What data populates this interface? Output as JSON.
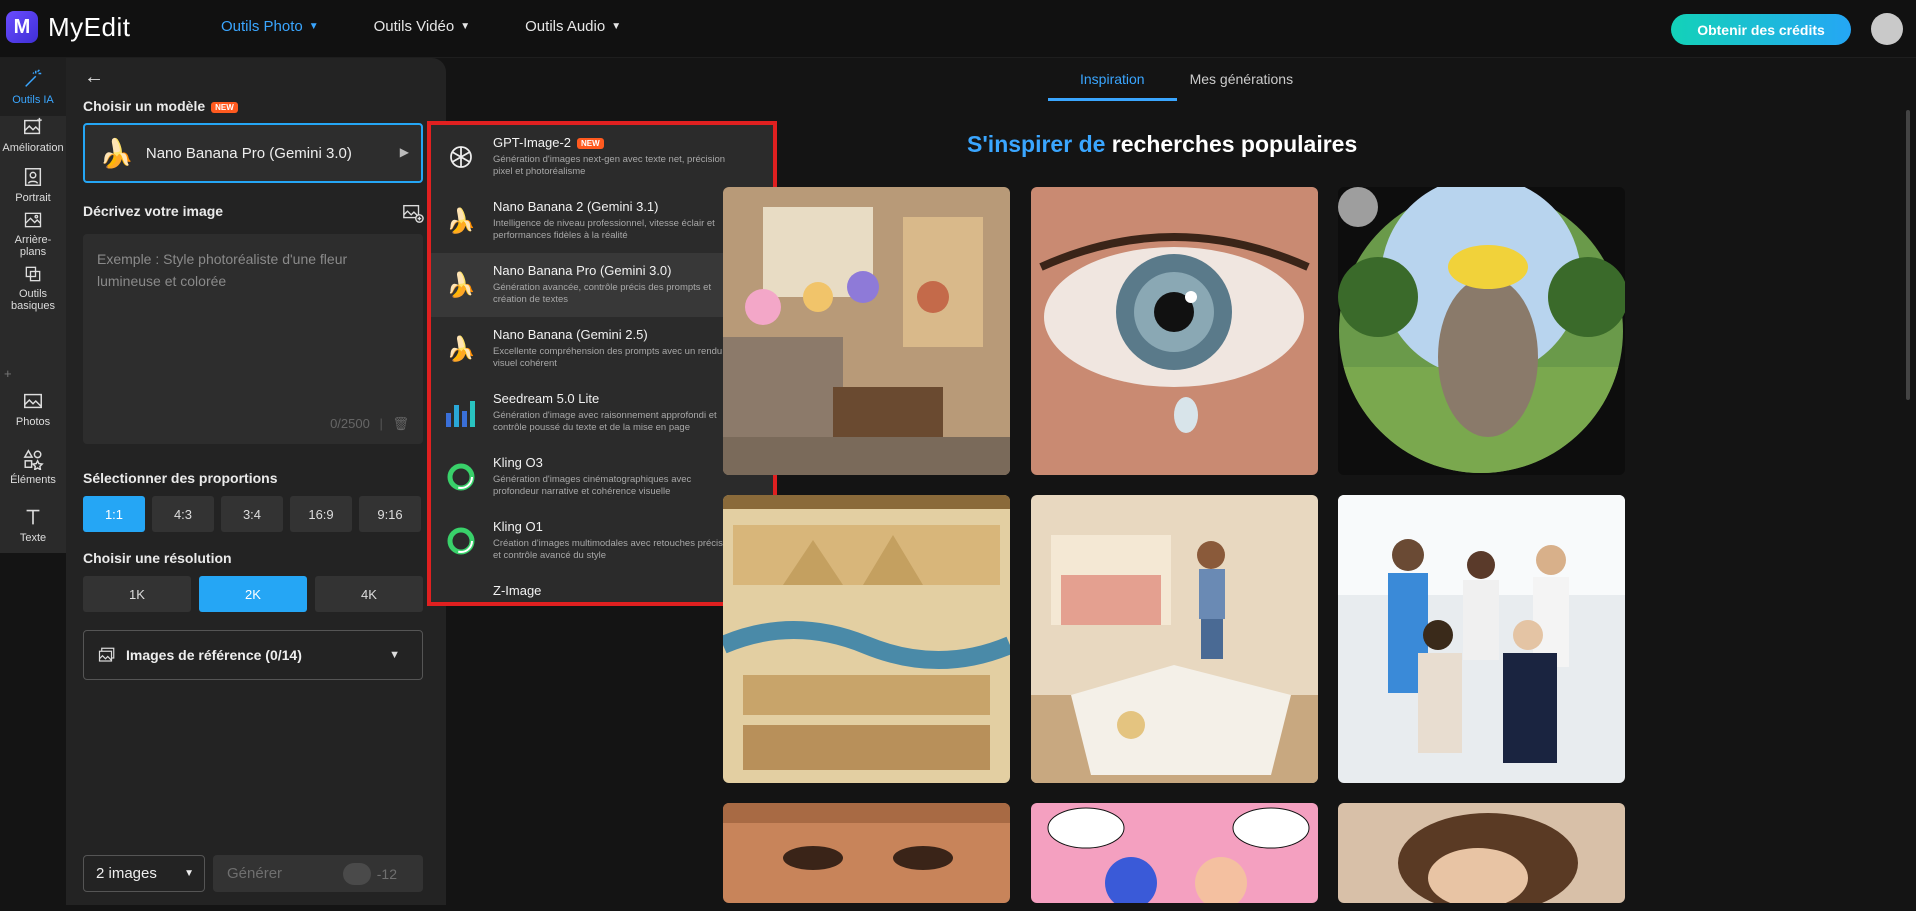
{
  "app": {
    "logo_letter": "M",
    "name": "MyEdit"
  },
  "nav": [
    {
      "label": "Outils Photo",
      "active": true
    },
    {
      "label": "Outils Vidéo",
      "active": false
    },
    {
      "label": "Outils Audio",
      "active": false
    }
  ],
  "header": {
    "credits_button": "Obtenir des crédits"
  },
  "rail": {
    "items": [
      {
        "label": "Outils IA",
        "icon": "magic-wand-icon"
      },
      {
        "label": "Amélioration",
        "icon": "enhance-icon"
      },
      {
        "label": "Portrait",
        "icon": "portrait-icon"
      },
      {
        "label": "Arrière-plans",
        "icon": "background-icon"
      },
      {
        "label": "Outils basiques",
        "icon": "crop-icon"
      },
      {
        "label": "Photos",
        "icon": "photo-icon"
      },
      {
        "label": "Éléments",
        "icon": "shapes-icon"
      },
      {
        "label": "Texte",
        "icon": "text-icon"
      }
    ]
  },
  "panel": {
    "model_label": "Choisir un modèle",
    "new_badge": "NEW",
    "selected_model": "Nano Banana Pro (Gemini 3.0)",
    "describe_label": "Décrivez votre image",
    "prompt_placeholder": "Exemple : Style photoréaliste d'une fleur lumineuse et colorée",
    "prompt_counter": "0/2500",
    "ratio_label": "Sélectionner des proportions",
    "ratios": [
      "1:1",
      "4:3",
      "3:4",
      "16:9",
      "9:16"
    ],
    "selected_ratio": "1:1",
    "resolution_label": "Choisir une résolution",
    "resolutions": [
      "1K",
      "2K",
      "4K"
    ],
    "selected_resolution": "2K",
    "reference_label": "Images de référence (0/14)",
    "count_value": "2 images",
    "generate_label": "Générer",
    "generate_cost": "-12"
  },
  "dropdown": {
    "items": [
      {
        "title": "GPT-Image-2",
        "badge": "NEW",
        "desc": "Génération d'images next-gen avec texte net, précision pixel et photoréalisme",
        "icon": "openai-icon"
      },
      {
        "title": "Nano Banana 2 (Gemini 3.1)",
        "desc": "Intelligence de niveau professionnel, vitesse éclair et performances fidèles à la réalité",
        "icon": "banana-icon"
      },
      {
        "title": "Nano Banana Pro (Gemini 3.0)",
        "desc": "Génération avancée, contrôle précis des prompts et création de textes",
        "icon": "banana-icon",
        "selected": true
      },
      {
        "title": "Nano Banana (Gemini 2.5)",
        "desc": "Excellente compréhension des prompts avec un rendu visuel cohérent",
        "icon": "banana-icon"
      },
      {
        "title": "Seedream 5.0 Lite",
        "desc": "Génération d'image avec raisonnement approfondi et contrôle poussé du texte et de la mise en page",
        "icon": "seedream-icon"
      },
      {
        "title": "Kling O3",
        "desc": "Génération d'images cinématographiques avec profondeur narrative et cohérence visuelle",
        "icon": "kling-icon"
      },
      {
        "title": "Kling O1",
        "desc": "Création d'images multimodales avec retouches précises et contrôle avancé du style",
        "icon": "kling-icon"
      },
      {
        "title": "Z-Image",
        "desc": "",
        "icon": "z-image-icon"
      }
    ]
  },
  "main": {
    "tabs": [
      {
        "label": "Inspiration",
        "active": true
      },
      {
        "label": "Mes générations",
        "active": false
      }
    ],
    "title_blue": "S'inspirer de",
    "title_white": "recherches populaires",
    "tiles": [
      "anime-girls-living-room",
      "crying-eye-closeup",
      "fisheye-elephant-banana",
      "egyptian-dynasties-scroll",
      "girl-storybook-bedroom",
      "medical-team-portrait",
      "woman-face-closeup",
      "comic-couple",
      "sleeping-woman"
    ],
    "colors": {
      "accent": "#3aa6ff",
      "highlight": "#e02020"
    }
  }
}
